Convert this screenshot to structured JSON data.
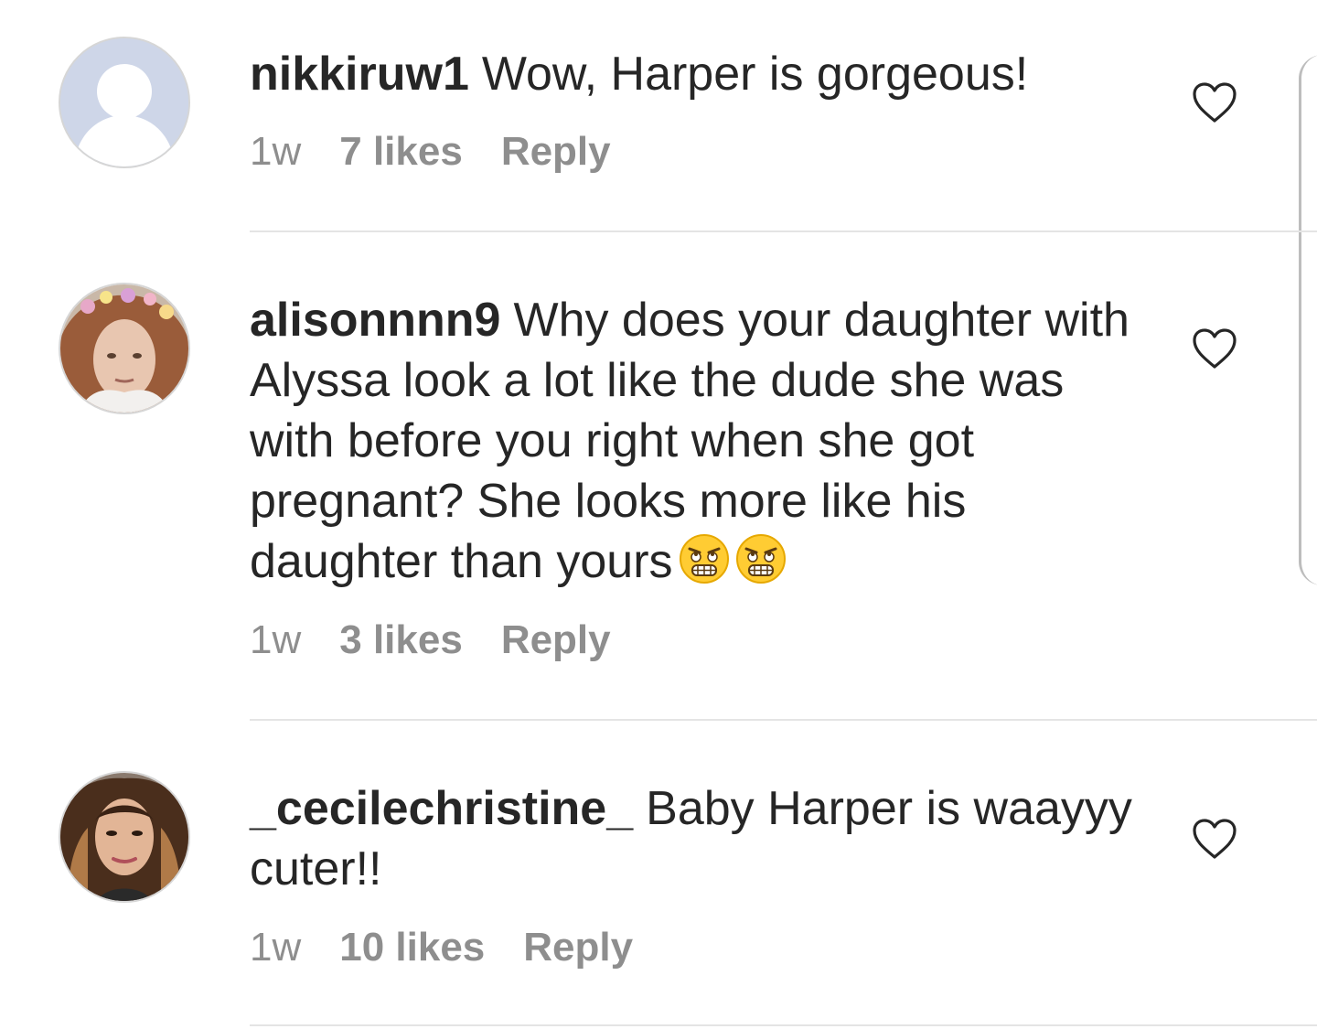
{
  "comments": [
    {
      "username": "nikkiruw1",
      "text": "Wow, Harper is gorgeous!",
      "time": "1w",
      "likes": "7 likes",
      "reply": "Reply"
    },
    {
      "username": "alisonnnn9",
      "text": "Why does your daughter with Alyssa look a lot like the dude she was with before you right when she got pregnant? She looks more like his daughter than yours",
      "time": "1w",
      "likes": "3 likes",
      "reply": "Reply"
    },
    {
      "username": "_cecilechristine_",
      "text": "Baby Harper is waayyy cuter!!",
      "time": "1w",
      "likes": "10 likes",
      "reply": "Reply"
    }
  ],
  "colors": {
    "text": "#262626",
    "meta": "#8e8e8e",
    "divider": "#e4e4e4",
    "default_avatar_bg": "#ced6e8"
  },
  "icons": {
    "like": "heart-outline-icon",
    "emoji": "grimacing-rolling-eyes-emoji"
  }
}
